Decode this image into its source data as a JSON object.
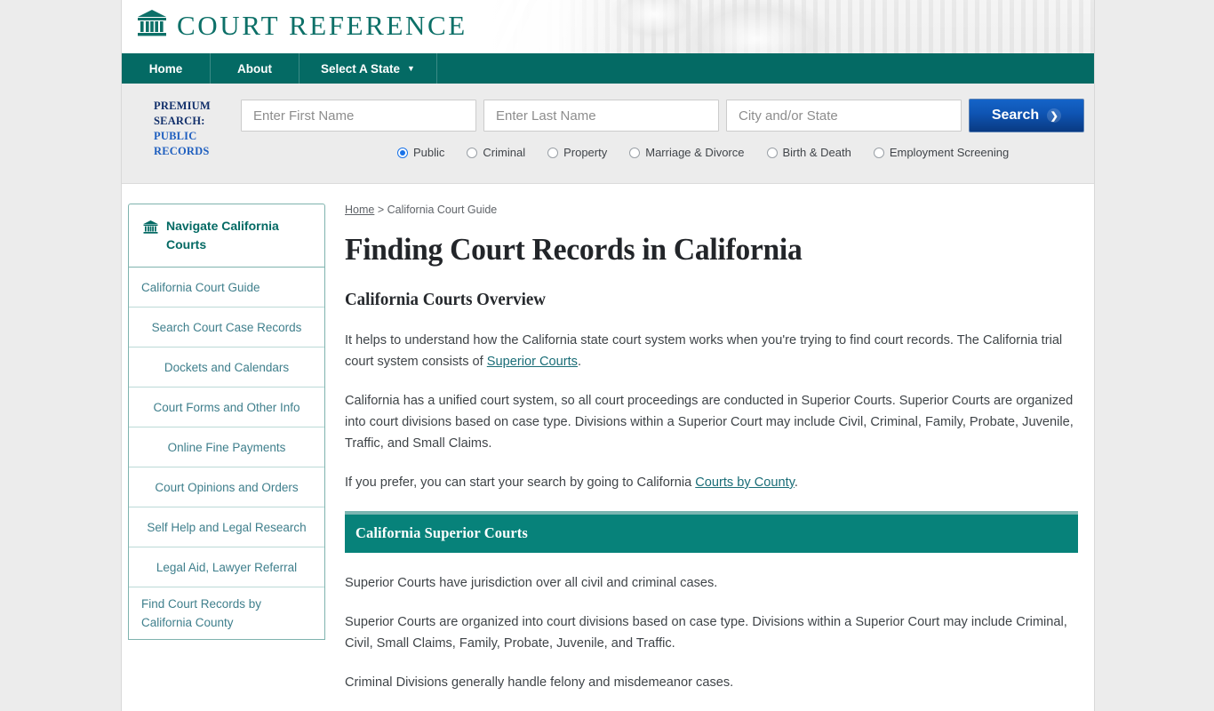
{
  "brand": {
    "name": "COURT REFERENCE",
    "logo_icon": "courthouse-icon"
  },
  "nav": {
    "items": [
      {
        "label": "Home",
        "caret": ""
      },
      {
        "label": "About",
        "caret": ""
      },
      {
        "label": "Select A State",
        "caret": "▼"
      }
    ]
  },
  "search": {
    "premium_line1": "PREMIUM",
    "premium_line2": "SEARCH:",
    "premium_line3": "PUBLIC",
    "premium_line4": "RECORDS",
    "first_name_placeholder": "Enter First Name",
    "first_name_value": "",
    "last_name_placeholder": "Enter Last Name",
    "last_name_value": "",
    "city_state_placeholder": "City and/or State",
    "city_state_value": "",
    "button_label": "Search",
    "button_icon": "chevron-right-icon",
    "button_color": "#0f55b4",
    "radios": [
      {
        "label": "Public",
        "selected": true
      },
      {
        "label": "Criminal",
        "selected": false
      },
      {
        "label": "Property",
        "selected": false
      },
      {
        "label": "Marriage & Divorce",
        "selected": false
      },
      {
        "label": "Birth & Death",
        "selected": false
      },
      {
        "label": "Employment Screening",
        "selected": false
      }
    ]
  },
  "sidebar": {
    "header_icon": "courthouse-icon",
    "header": "Navigate California Courts",
    "items": [
      {
        "label": "California Court Guide",
        "align": "left"
      },
      {
        "label": "Search Court Case Records",
        "align": "center"
      },
      {
        "label": "Dockets and Calendars",
        "align": "center"
      },
      {
        "label": "Court Forms and Other Info",
        "align": "center"
      },
      {
        "label": "Online Fine Payments",
        "align": "center"
      },
      {
        "label": "Court Opinions and Orders",
        "align": "center"
      },
      {
        "label": "Self Help and Legal Research",
        "align": "center"
      },
      {
        "label": "Legal Aid, Lawyer Referral",
        "align": "center"
      },
      {
        "label": "Find Court Records by California County",
        "align": "left"
      }
    ]
  },
  "breadcrumb": {
    "home": "Home",
    "separator": " > ",
    "current": "California Court Guide"
  },
  "main": {
    "title": "Finding Court Records in California",
    "subhead": "California Courts Overview",
    "p1_before": "It helps to understand how the California state court system works when you're trying to find court records. The California trial court system consists of ",
    "p1_link": "Superior Courts",
    "p1_after": ".",
    "p2": "California has a unified court system, so all court proceedings are conducted in Superior Courts. Superior Courts are organized into court divisions based on case type. Divisions within a Superior Court may include Civil, Criminal, Family, Probate, Juvenile, Traffic, and Small Claims.",
    "p3_before": "If you prefer, you can start your search by going to California ",
    "p3_link": "Courts by County",
    "p3_after": ".",
    "section_heading": "California Superior Courts",
    "section_heading_color": "#07827a",
    "p4": "Superior Courts have jurisdiction over all civil and criminal cases.",
    "p5": "Superior Courts are organized into court divisions based on case type. Divisions within a Superior Court may include Criminal, Civil, Small Claims, Family, Probate, Juvenile, and Traffic.",
    "p6": "Criminal Divisions generally handle felony and misdemeanor cases."
  },
  "theme": {
    "teal": "#046a64",
    "page_background": "#ececec",
    "link_teal": "#1a6d77"
  }
}
